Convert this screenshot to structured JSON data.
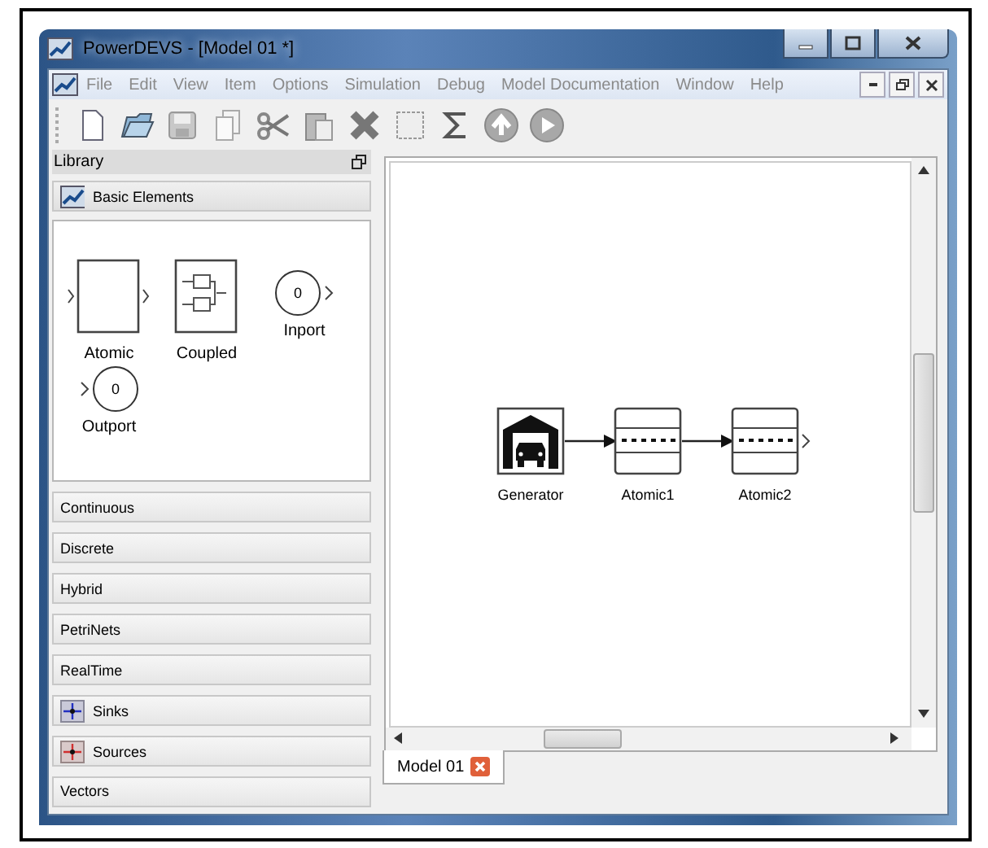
{
  "window": {
    "title": "PowerDEVS - [Model 01 *]"
  },
  "menu": [
    "File",
    "Edit",
    "View",
    "Item",
    "Options",
    "Simulation",
    "Debug",
    "Model Documentation",
    "Window",
    "Help"
  ],
  "library": {
    "title": "Library",
    "sections": [
      {
        "label": "Basic Elements",
        "kind": "basic",
        "expanded": true,
        "items": [
          {
            "label": "Atomic",
            "kind": "atomic"
          },
          {
            "label": "Coupled",
            "kind": "coupled"
          },
          {
            "label": "Inport",
            "kind": "inport",
            "value": "0"
          },
          {
            "label": "Outport",
            "kind": "outport",
            "value": "0"
          }
        ]
      },
      {
        "label": "Continuous",
        "kind": "plain",
        "expanded": false
      },
      {
        "label": "Discrete",
        "kind": "plain",
        "expanded": false
      },
      {
        "label": "Hybrid",
        "kind": "plain",
        "expanded": false
      },
      {
        "label": "PetriNets",
        "kind": "plain",
        "expanded": false
      },
      {
        "label": "RealTime",
        "kind": "plain",
        "expanded": false
      },
      {
        "label": "Sinks",
        "kind": "sinks",
        "expanded": false
      },
      {
        "label": "Sources",
        "kind": "sources",
        "expanded": false
      },
      {
        "label": "Vectors",
        "kind": "plain",
        "expanded": false
      }
    ]
  },
  "model": {
    "nodes": [
      {
        "label": "Generator",
        "kind": "generator",
        "output_connected": true
      },
      {
        "label": "Atomic1",
        "kind": "atomic",
        "output_connected": true
      },
      {
        "label": "Atomic2",
        "kind": "atomic",
        "output_connected": false
      }
    ]
  },
  "tabs": [
    {
      "label": "Model 01",
      "selected": true
    }
  ]
}
